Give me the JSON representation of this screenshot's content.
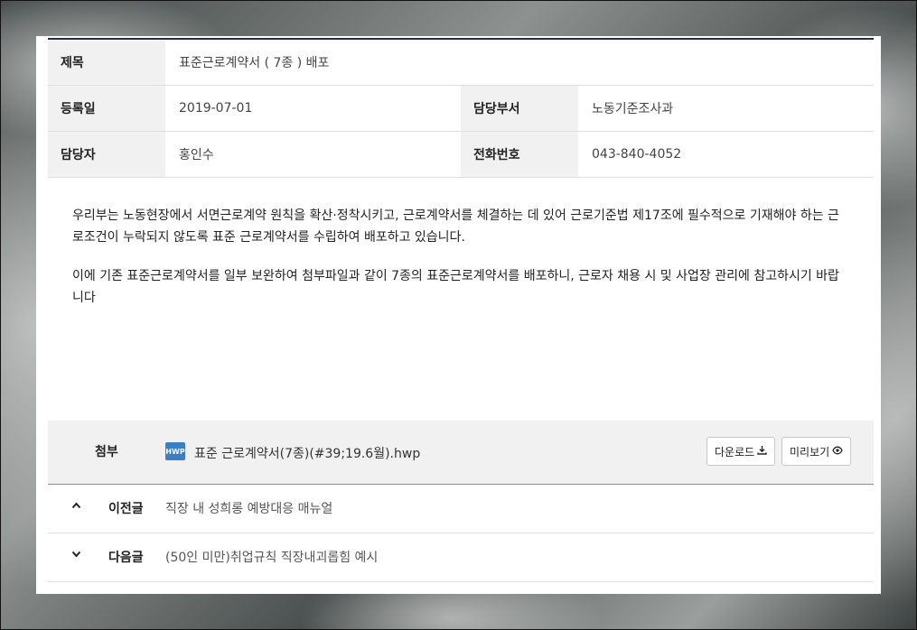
{
  "info": {
    "title_label": "제목",
    "title_value": "표준근로계약서 ( 7종 ) 배포",
    "date_label": "등록일",
    "date_value": "2019-07-01",
    "dept_label": "담당부서",
    "dept_value": "노동기준조사과",
    "person_label": "담당자",
    "person_value": "홍인수",
    "phone_label": "전화번호",
    "phone_value": "043-840-4052"
  },
  "content": {
    "para1": "우리부는 노동현장에서 서면근로계약 원칙을 확산·정착시키고, 근로계약서를 체결하는 데 있어 근로기준법 제17조에 필수적으로 기재해야 하는 근로조건이 누락되지 않도록 표준 근로계약서를 수립하여 배포하고 있습니다.",
    "para2": "이에 기존 표준근로계약서를 일부 보완하여 첨부파일과 같이 7종의 표준근로계약서를 배포하니, 근로자 채용 시 및 사업장 관리에 참고하시기 바랍니다"
  },
  "attachment": {
    "label": "첨부",
    "file_icon": "HWP",
    "file_name": "표준 근로계약서(7종)(#39;19.6월).hwp",
    "download_label": "다운로드",
    "preview_label": "미리보기"
  },
  "navigation": {
    "prev_label": "이전글",
    "prev_title": "직장 내 성희롱 예방대응 매뉴얼",
    "next_label": "다음글",
    "next_title": "(50인 미만)취업규칙 직장내괴롭힘 예시"
  }
}
